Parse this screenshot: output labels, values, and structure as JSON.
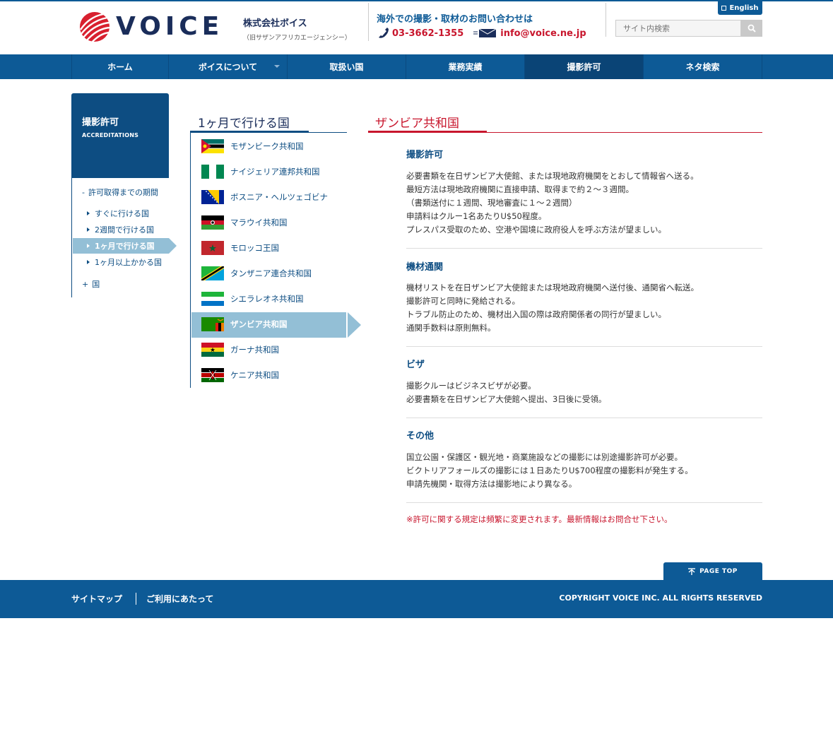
{
  "header": {
    "logo_text": "VOICE",
    "company_name": "株式会社ボイス",
    "company_sub": "（旧サザンアフリカエージェンシー）",
    "contact_title": "海外での撮影・取材のお問い合わせは",
    "phone": "03-3662-1355",
    "email": "info@voice.ne.jp",
    "english_label": "English",
    "search_placeholder": "サイト内検索"
  },
  "nav": {
    "items": [
      {
        "label": "ホーム"
      },
      {
        "label": "ボイスについて"
      },
      {
        "label": "取扱い国"
      },
      {
        "label": "業務実績"
      },
      {
        "label": "撮影許可"
      },
      {
        "label": "ネタ検索"
      }
    ]
  },
  "sidebar": {
    "title": "撮影許可",
    "title_en": "ACCREDITATIONS",
    "section1": {
      "mark": "-",
      "label": "許可取得までの期間"
    },
    "items": [
      {
        "label": "すぐに行ける国"
      },
      {
        "label": "2週間で行ける国"
      },
      {
        "label": "1ヶ月で行ける国"
      },
      {
        "label": "1ヶ月以上かかる国"
      }
    ],
    "section2": {
      "mark": "+",
      "label": "国"
    }
  },
  "middle": {
    "title": "1ヶ月で行ける国",
    "countries": [
      {
        "label": "モザンビーク共和国"
      },
      {
        "label": "ナイジェリア連邦共和国"
      },
      {
        "label": "ボスニア・ヘルツェゴビナ"
      },
      {
        "label": "マラウイ共和国"
      },
      {
        "label": "モロッコ王国"
      },
      {
        "label": "タンザニア連合共和国"
      },
      {
        "label": "シエラレオネ共和国"
      },
      {
        "label": "ザンビア共和国"
      },
      {
        "label": "ガーナ共和国"
      },
      {
        "label": "ケニア共和国"
      }
    ]
  },
  "content": {
    "title": "ザンビア共和国",
    "sections": [
      {
        "heading": "撮影許可",
        "body": "必要書類を在日ザンビア大使館、または現地政府機関をとおして情報省へ送る。\n最短方法は現地政府機関に直接申請、取得まで約２～３週間。\n（書類送付に１週間、現地審査に１～２週間）\n申請料はクルー1名あたりU$50程度。\nプレスパス受取のため、空港や国境に政府役人を呼ぶ方法が望ましい。"
      },
      {
        "heading": "機材通関",
        "body": "機材リストを在日ザンビア大使館または現地政府機関へ送付後、通関省へ転送。\n撮影許可と同時に発給される。\nトラブル防止のため、機材出入国の際は政府関係者の同行が望ましい。\n通関手数料は原則無料。"
      },
      {
        "heading": "ビザ",
        "body": "撮影クルーはビジネスビザが必要。\n必要書類を在日ザンビア大使館へ提出、3日後に受領。"
      },
      {
        "heading": "その他",
        "body": "国立公園・保護区・観光地・商業施設などの撮影には別途撮影許可が必要。\nビクトリアフォールズの撮影には１日あたりU$700程度の撮影料が発生する。\n申請先機関・取得方法は撮影地により異なる。"
      }
    ],
    "note": "※許可に関する規定は頻繁に変更されます。最新情報はお問合せ下さい。"
  },
  "footer": {
    "pagetop": "PAGE TOP",
    "links": [
      {
        "label": "サイトマップ"
      },
      {
        "label": "ご利用にあたって"
      }
    ],
    "copyright": "COPYRIGHT VOICE INC. ALL RIGHTS RESERVED"
  },
  "colors": {
    "brand_blue": "#0d5a96",
    "dark_blue": "#0d4d82",
    "accent_red": "#c8162d",
    "active_light_blue": "#93bfd6"
  },
  "icons": [
    "voice-logo-icon",
    "phone-icon",
    "mail-icon",
    "external-link-icon",
    "search-icon",
    "page-top-arrow-icon"
  ]
}
